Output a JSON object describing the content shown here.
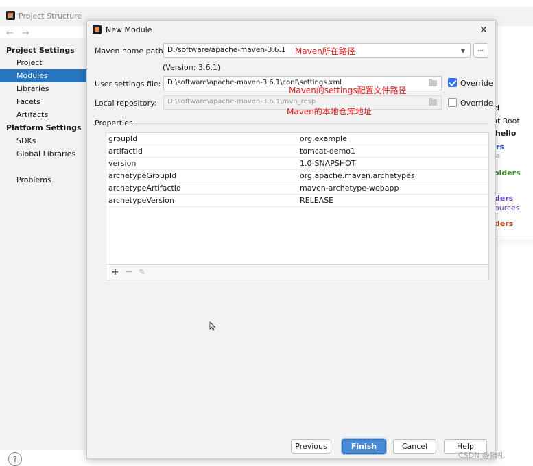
{
  "background_window": {
    "title": "Project Structure",
    "nav_arrows": "← →",
    "sidebar": {
      "section_project_settings": "Project Settings",
      "items_project": [
        "Project",
        "Modules",
        "Libraries",
        "Facets",
        "Artifacts"
      ],
      "selected_item": "Modules",
      "section_platform_settings": "Platform Settings",
      "items_platform": [
        "SDKs",
        "Global Libraries"
      ],
      "problems": "Problems"
    },
    "help_button": "?",
    "right_fragments": {
      "content_root": "nt Root",
      "hello": "\\hello",
      "rs": "rs",
      "a": "a",
      "olders": "olders",
      "ders1": "ders",
      "ources": "ources",
      "ders2": "ders",
      "d": "d"
    }
  },
  "dialog": {
    "title": "New Module",
    "maven_home_label": "Maven home path:",
    "maven_home_value": "D:/software/apache-maven-3.6.1",
    "maven_version": "(Version: 3.6.1)",
    "user_settings_label": "User settings file:",
    "user_settings_value": "D:\\software\\apache-maven-3.6.1\\conf\\settings.xml",
    "user_settings_override": "Override",
    "user_settings_override_checked": true,
    "local_repo_label": "Local repository:",
    "local_repo_value": "D:\\software\\apache-maven-3.6.1\\mvn_resp",
    "local_repo_override": "Override",
    "local_repo_override_checked": false,
    "browse_label": "...",
    "properties_label": "Properties",
    "properties": [
      {
        "key": "groupId",
        "value": "org.example"
      },
      {
        "key": "artifactId",
        "value": "tomcat-demo1"
      },
      {
        "key": "version",
        "value": "1.0-SNAPSHOT"
      },
      {
        "key": "archetypeGroupId",
        "value": "org.apache.maven.archetypes"
      },
      {
        "key": "archetypeArtifactId",
        "value": "maven-archetype-webapp"
      },
      {
        "key": "archetypeVersion",
        "value": "RELEASE"
      }
    ],
    "toolbar": {
      "add": "+",
      "remove": "−",
      "edit": "✎"
    },
    "buttons": {
      "previous": "Previous",
      "finish": "Finish",
      "cancel": "Cancel",
      "help": "Help"
    }
  },
  "annotations": {
    "maven_home": "Maven所在路径",
    "settings": "Maven的settings配置文件路径",
    "local_repo": "Maven的本地仓库地址"
  },
  "watermark": "CSDN @鍋礼",
  "colors": {
    "accent": "#2675bf",
    "primary_button": "#4a8bd9",
    "annotation": "#e02020",
    "checkbox": "#3574f0"
  }
}
